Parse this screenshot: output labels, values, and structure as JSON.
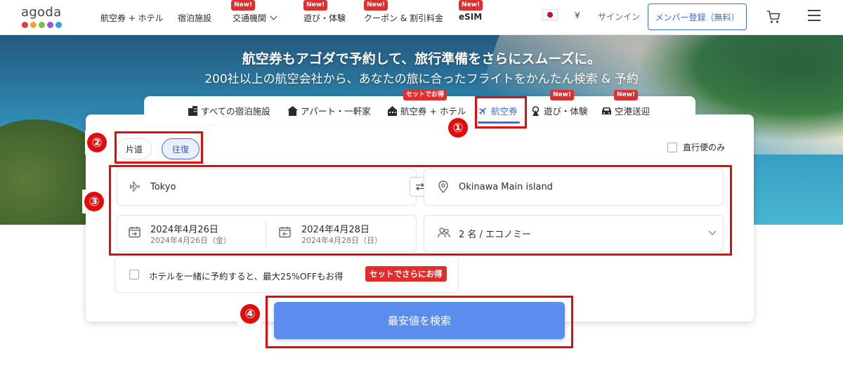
{
  "brand": {
    "name": "agoda",
    "dot_colors": [
      "#e83b3b",
      "#f2a13c",
      "#7ac143",
      "#9b51e0",
      "#2aa6e0"
    ]
  },
  "nav": {
    "items": [
      {
        "label": "航空券 + ホテル",
        "new": false
      },
      {
        "label": "宿泊施設",
        "new": false
      },
      {
        "label": "交通機関",
        "new": true,
        "dropdown": true
      },
      {
        "label": "遊び・体験",
        "new": true
      },
      {
        "label": "クーポン & 割引料金",
        "new": true
      },
      {
        "label": "eSIM",
        "new": true
      }
    ],
    "new_tag": "New!",
    "currency": "¥",
    "signin": "サインイン",
    "register": "メンバー登録（無料）"
  },
  "hero": {
    "title": "航空券もアゴダで予約して、旅行準備をさらにスムーズに。",
    "subtitle": "200社以上の航空会社から、あなたの旅に合ったフライトをかんたん検索 & 予約"
  },
  "tabs": [
    {
      "label": "すべての宿泊施設",
      "icon": "hotel-icon"
    },
    {
      "label": "アパート・一軒家",
      "icon": "home-icon"
    },
    {
      "label": "航空券 + ホテル",
      "icon": "bundle-icon",
      "tag": "セットでお得"
    },
    {
      "label": "航空券",
      "icon": "plane-icon",
      "active": true
    },
    {
      "label": "遊び・体験",
      "icon": "activity-icon",
      "tag": "New!"
    },
    {
      "label": "空港送迎",
      "icon": "car-icon",
      "tag": "New!"
    }
  ],
  "search": {
    "trip_types": [
      "片道",
      "往復"
    ],
    "selected_trip": "往復",
    "direct_only": "直行便のみ",
    "from": "Tokyo",
    "to": "Okinawa Main island",
    "depart_date": "2024年4月26日",
    "depart_sub": "2024年4月26日（金）",
    "return_date": "2024年4月28日",
    "return_sub": "2024年4月28日（日）",
    "passengers": "2 名 / エコノミー",
    "bundle_text": "ホテルを一緒に予約すると、最大25%OFFもお得",
    "bundle_badge": "セットでさらにお得",
    "search_button": "最安値を検索"
  },
  "annotations": [
    "①",
    "②",
    "③",
    "④"
  ]
}
